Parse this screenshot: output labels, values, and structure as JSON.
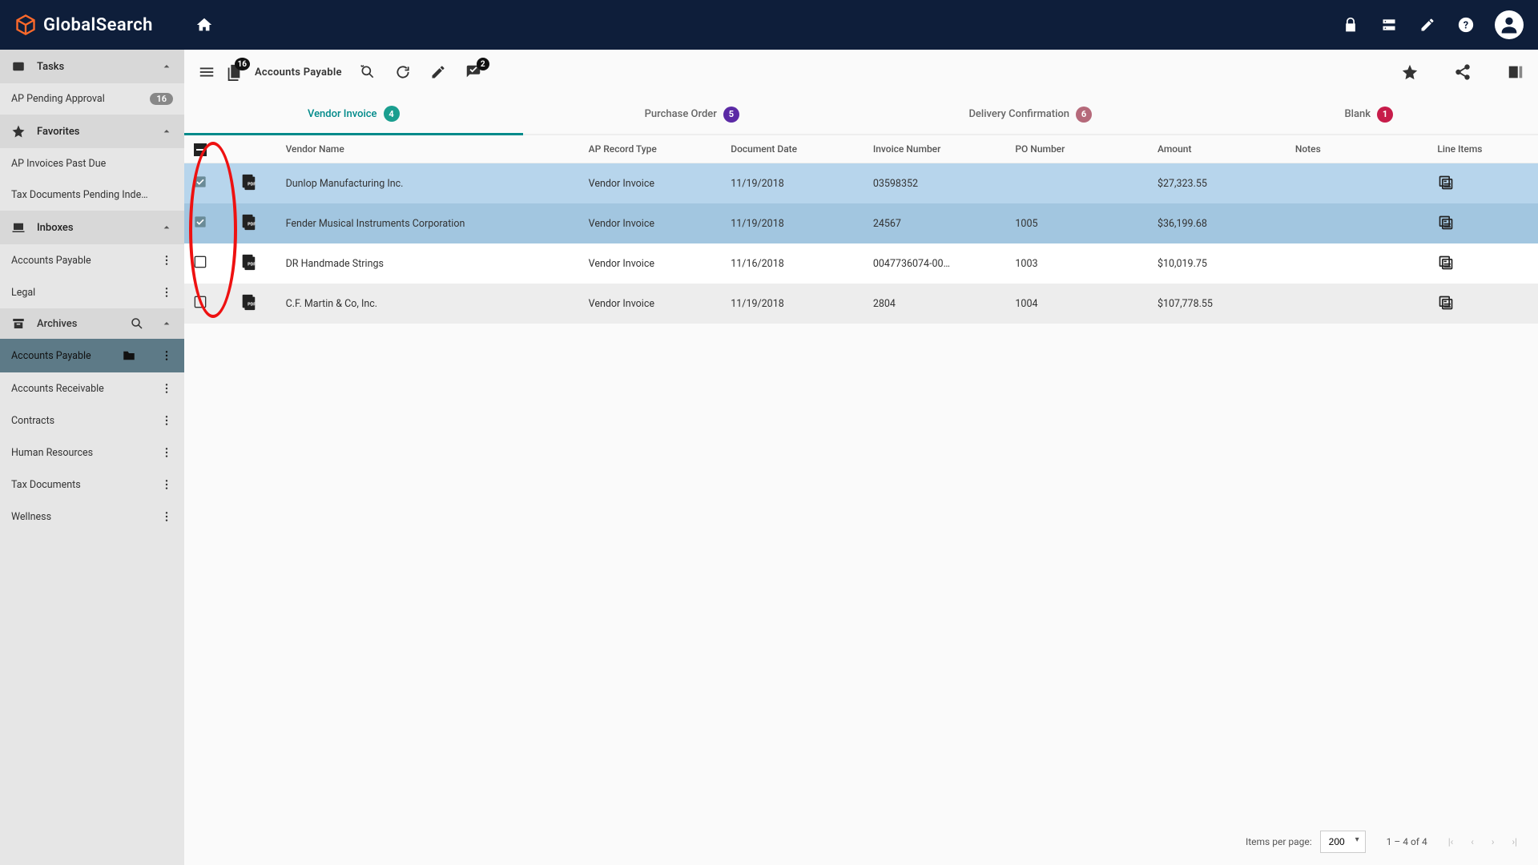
{
  "app": {
    "name": "GlobalSearch"
  },
  "toolbar": {
    "docs_badge": "16",
    "title": "Accounts Payable",
    "approve_badge": "2"
  },
  "sidebar": {
    "tasks": {
      "label": "Tasks",
      "items": [
        {
          "label": "AP Pending Approval",
          "count": "16"
        }
      ]
    },
    "favorites": {
      "label": "Favorites",
      "items": [
        {
          "label": "AP Invoices Past Due"
        },
        {
          "label": "Tax Documents Pending Inde…"
        }
      ]
    },
    "inboxes": {
      "label": "Inboxes",
      "items": [
        {
          "label": "Accounts Payable"
        },
        {
          "label": "Legal"
        }
      ]
    },
    "archives": {
      "label": "Archives",
      "items": [
        {
          "label": "Accounts Payable",
          "active": true
        },
        {
          "label": "Accounts Receivable"
        },
        {
          "label": "Contracts"
        },
        {
          "label": "Human Resources"
        },
        {
          "label": "Tax Documents"
        },
        {
          "label": "Wellness"
        }
      ]
    }
  },
  "tabs": [
    {
      "label": "Vendor Invoice",
      "badge": "4",
      "color": "teal",
      "active": true
    },
    {
      "label": "Purchase Order",
      "badge": "5",
      "color": "purple"
    },
    {
      "label": "Delivery Confirmation",
      "badge": "6",
      "color": "mauve"
    },
    {
      "label": "Blank",
      "badge": "1",
      "color": "crimson"
    }
  ],
  "columns": {
    "vendor": "Vendor Name",
    "rectype": "AP Record Type",
    "docdate": "Document Date",
    "inv": "Invoice Number",
    "po": "PO Number",
    "amount": "Amount",
    "notes": "Notes",
    "line": "Line Items"
  },
  "rows": [
    {
      "selected": true,
      "vendor": "Dunlop Manufacturing Inc.",
      "rectype": "Vendor Invoice",
      "docdate": "11/19/2018",
      "inv": "03598352",
      "po": "",
      "amount": "$27,323.55"
    },
    {
      "selected": true,
      "vendor": "Fender Musical Instruments Corporation",
      "rectype": "Vendor Invoice",
      "docdate": "11/19/2018",
      "inv": "24567",
      "po": "1005",
      "amount": "$36,199.68"
    },
    {
      "selected": false,
      "vendor": "DR Handmade Strings",
      "rectype": "Vendor Invoice",
      "docdate": "11/16/2018",
      "inv": "0047736074-00…",
      "po": "1003",
      "amount": "$10,019.75"
    },
    {
      "selected": false,
      "vendor": "C.F. Martin & Co, Inc.",
      "rectype": "Vendor Invoice",
      "docdate": "11/19/2018",
      "inv": "2804",
      "po": "1004",
      "amount": "$107,778.55"
    }
  ],
  "paginator": {
    "label": "Items per page:",
    "per_page": "200",
    "range": "1 – 4 of 4"
  }
}
